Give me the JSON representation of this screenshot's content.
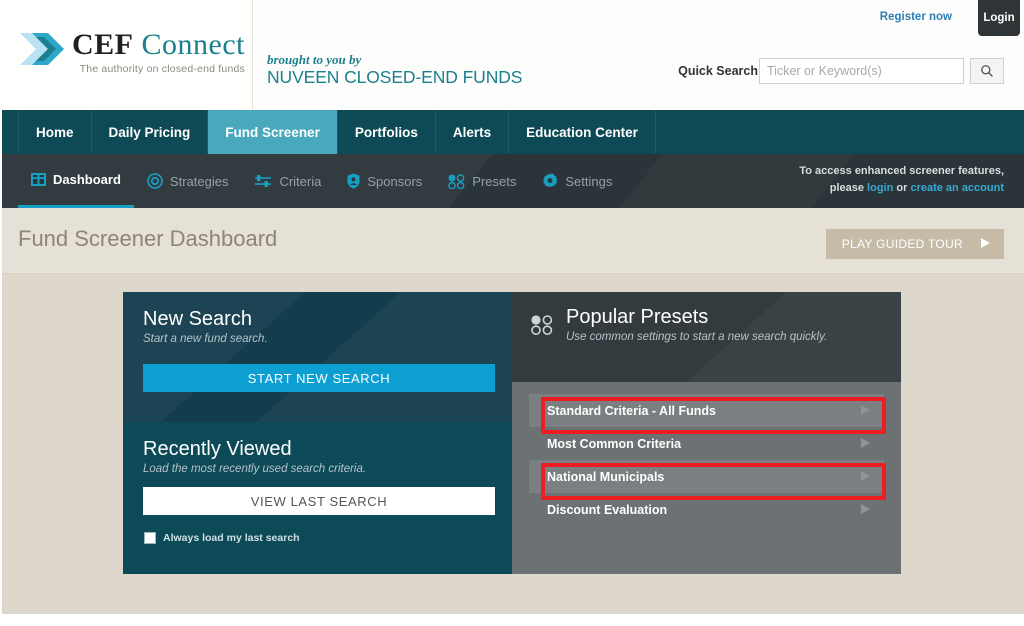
{
  "header": {
    "logo": {
      "part1": "CEF",
      "part2": "Connect",
      "tagline": "The authority on closed-end funds"
    },
    "brought_line1": "brought to you by",
    "brought_line2": "NUVEEN CLOSED-END FUNDS",
    "register_label": "Register now",
    "login_label": "Login",
    "quick_search_label": "Quick Search",
    "quick_search_placeholder": "Ticker or Keyword(s)",
    "quick_search_value": "",
    "search_icon": "search-icon"
  },
  "mainnav": {
    "items": [
      {
        "label": "Home",
        "active": false
      },
      {
        "label": "Daily Pricing",
        "active": false
      },
      {
        "label": "Fund Screener",
        "active": true
      },
      {
        "label": "Portfolios",
        "active": false
      },
      {
        "label": "Alerts",
        "active": false
      },
      {
        "label": "Education Center",
        "active": false
      }
    ]
  },
  "subnav": {
    "items": [
      {
        "label": "Dashboard",
        "icon": "dashboard-icon",
        "active": true
      },
      {
        "label": "Strategies",
        "icon": "target-circle-icon",
        "active": false
      },
      {
        "label": "Criteria",
        "icon": "sliders-icon",
        "active": false
      },
      {
        "label": "Sponsors",
        "icon": "shield-icon",
        "active": false
      },
      {
        "label": "Presets",
        "icon": "four-dots-icon",
        "active": false
      },
      {
        "label": "Settings",
        "icon": "gear-icon",
        "active": false
      }
    ],
    "note_line1": "To access enhanced screener features,",
    "note_please": "please ",
    "note_login": "login",
    "note_or": " or ",
    "note_create": "create an account"
  },
  "titlebar": {
    "title": "Fund Screener Dashboard",
    "tour_label": "PLAY GUIDED TOUR",
    "tour_icon": "play-triangle-icon"
  },
  "new_search": {
    "heading": "New Search",
    "subtext": "Start a new fund search.",
    "button_label": "START NEW SEARCH"
  },
  "recently_viewed": {
    "heading": "Recently Viewed",
    "subtext": "Load the most recently used search criteria.",
    "button_label": "VIEW LAST SEARCH",
    "checkbox_label": "Always load my last search",
    "checkbox_checked": false
  },
  "popular_presets": {
    "heading": "Popular Presets",
    "subtext": "Use common settings to start a new search quickly.",
    "icon": "four-dots-icon",
    "items": [
      {
        "label": "Standard Criteria - All Funds",
        "highlighted": true,
        "annotated": true
      },
      {
        "label": "Most Common Criteria",
        "highlighted": false,
        "annotated": false
      },
      {
        "label": "National Municipals",
        "highlighted": true,
        "annotated": true
      },
      {
        "label": "Discount Evaluation",
        "highlighted": false,
        "annotated": false
      }
    ]
  },
  "colors": {
    "brand_teal": "#1b7f8e",
    "nav_dark_teal": "#0d4a55",
    "nav_active": "#4aa8bd",
    "accent_blue": "#0e9fd2",
    "annotation_red": "#ee1d23",
    "page_beige": "#ddd8cb",
    "title_beige": "#e6e1d6"
  }
}
